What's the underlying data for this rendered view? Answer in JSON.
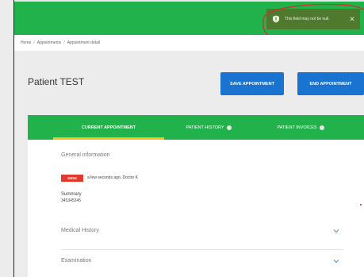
{
  "toast": {
    "message": "This field may not be null.",
    "icon": "shield-alert-icon",
    "close_icon": "close-icon",
    "close_glyph": "✕"
  },
  "breadcrumb": {
    "items": [
      "Home",
      "Appointments",
      "Appointment detail"
    ],
    "separator": "/"
  },
  "header": {
    "title": "Patient TEST",
    "save_label": "SAVE APPOINTMENT",
    "end_label": "END APPOINTMENT"
  },
  "tabs": [
    {
      "label": "CURRENT APPOINTMENT",
      "active": true
    },
    {
      "label": "PATIENT HISTORY",
      "badge": true
    },
    {
      "label": "PATIENT INVOICES",
      "badge": true
    }
  ],
  "general_info": {
    "title": "General information",
    "priority": "HIGH",
    "meta": "a few seconds ago, Doctor K",
    "summary_label": "Summary",
    "summary_value": "345345345"
  },
  "sections": [
    {
      "title": "Medical History",
      "icon": "chevron-down-icon"
    },
    {
      "title": "Examination",
      "icon": "chevron-down-icon"
    }
  ],
  "colors": {
    "brand_green": "#22b24c",
    "primary_blue": "#1a73d1",
    "tab_indicator": "#f2c21b",
    "priority_red": "#e23a2e",
    "annotation_red": "#d62a2a"
  }
}
